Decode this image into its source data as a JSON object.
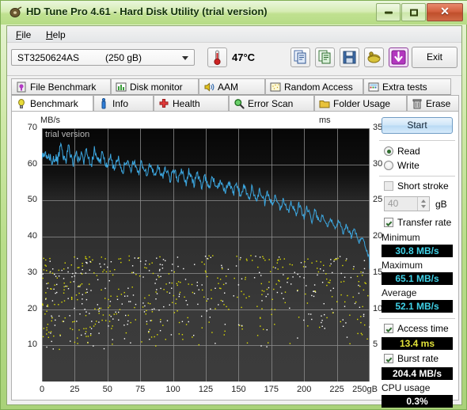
{
  "window": {
    "title": "HD Tune Pro 4.61 - Hard Disk Utility (trial version)",
    "icon": "hdtune-app-icon",
    "minimize_label": "",
    "maximize_label": "",
    "close_label": "✕"
  },
  "menu": [
    {
      "label": "File",
      "accel": "F"
    },
    {
      "label": "Help",
      "accel": "H"
    }
  ],
  "toolbar": {
    "drive_model": "ST3250624AS",
    "drive_capacity": "(250 gB)",
    "temperature": "47°C",
    "temp_icon": "thermometer-icon",
    "buttons": [
      {
        "icon": "copy-icon"
      },
      {
        "icon": "export-icon"
      },
      {
        "icon": "save-icon"
      },
      {
        "icon": "options-icon"
      },
      {
        "icon": "download-arrow-icon"
      }
    ],
    "exit_label": "Exit"
  },
  "tabs_row1": [
    {
      "label": "File Benchmark",
      "icon": "file-benchmark-icon",
      "active": false
    },
    {
      "label": "Disk monitor",
      "icon": "disk-monitor-icon",
      "active": false
    },
    {
      "label": "AAM",
      "icon": "speaker-icon",
      "active": false
    },
    {
      "label": "Random Access",
      "icon": "random-access-icon",
      "active": false
    },
    {
      "label": "Extra tests",
      "icon": "extra-tests-icon",
      "active": false
    }
  ],
  "tabs_row2": [
    {
      "label": "Benchmark",
      "icon": "lightbulb-icon",
      "active": true
    },
    {
      "label": "Info",
      "icon": "info-icon",
      "active": false
    },
    {
      "label": "Health",
      "icon": "health-cross-icon",
      "active": false
    },
    {
      "label": "Error Scan",
      "icon": "magnifier-icon",
      "active": false
    },
    {
      "label": "Folder Usage",
      "icon": "folder-icon",
      "active": false
    },
    {
      "label": "Erase",
      "icon": "trash-icon",
      "active": false
    }
  ],
  "sidebar": {
    "start_label": "Start",
    "mode": [
      {
        "label": "Read",
        "selected": true
      },
      {
        "label": "Write",
        "selected": false
      }
    ],
    "short_stroke": {
      "label": "Short stroke",
      "checked": false,
      "value": "40",
      "unit": "gB"
    },
    "transfer_rate": {
      "label": "Transfer rate",
      "checked": true
    },
    "minimum": {
      "caption": "Minimum",
      "value": "30.8 MB/s"
    },
    "maximum": {
      "caption": "Maximum",
      "value": "65.1 MB/s"
    },
    "average": {
      "caption": "Average",
      "value": "52.1 MB/s"
    },
    "access_time": {
      "label": "Access time",
      "checked": true,
      "value": "13.4 ms"
    },
    "burst_rate": {
      "label": "Burst rate",
      "checked": true,
      "value": "204.4 MB/s"
    },
    "cpu_usage": {
      "caption": "CPU usage",
      "value": "0.3%"
    }
  },
  "chart_data": {
    "type": "line",
    "title": "",
    "watermark": "trial version",
    "xlabel": "",
    "ylabel": "MB/s",
    "ylabel_right": "ms",
    "xlim": [
      0,
      250
    ],
    "ylim": [
      0,
      70
    ],
    "ylim_right": [
      0,
      35
    ],
    "xticks": [
      0,
      25,
      50,
      75,
      100,
      125,
      150,
      175,
      200,
      225,
      250
    ],
    "xtick_labels": [
      "0",
      "25",
      "50",
      "75",
      "100",
      "125",
      "150",
      "175",
      "200",
      "225",
      "250gB"
    ],
    "yticks": [
      10,
      20,
      30,
      40,
      50,
      60,
      70
    ],
    "ytick_labels": [
      "10",
      "20",
      "30",
      "40",
      "50",
      "60",
      "70"
    ],
    "yticks_right": [
      5,
      10,
      15,
      20,
      25,
      30,
      35
    ],
    "ytick_labels_right": [
      "5",
      "10",
      "15",
      "20",
      "25",
      "30",
      "35"
    ],
    "grid": true,
    "legend": "none",
    "series": [
      {
        "name": "Transfer rate",
        "type": "line",
        "color": "#3ca7e0",
        "axis": "left",
        "unit": "MB/s",
        "x": [
          0,
          2,
          4,
          6,
          8,
          10,
          12,
          14,
          16,
          18,
          20,
          22,
          24,
          26,
          28,
          30,
          32,
          34,
          36,
          38,
          40,
          42,
          44,
          46,
          48,
          50,
          52,
          54,
          56,
          58,
          60,
          62,
          64,
          66,
          68,
          70,
          72,
          74,
          76,
          78,
          80,
          82,
          84,
          86,
          88,
          90,
          92,
          94,
          96,
          98,
          100,
          102,
          104,
          106,
          108,
          110,
          112,
          114,
          116,
          118,
          120,
          122,
          124,
          126,
          128,
          130,
          132,
          134,
          136,
          138,
          140,
          142,
          144,
          146,
          148,
          150,
          152,
          154,
          156,
          158,
          160,
          162,
          164,
          166,
          168,
          170,
          172,
          174,
          176,
          178,
          180,
          182,
          184,
          186,
          188,
          190,
          192,
          194,
          196,
          198,
          200,
          202,
          204,
          206,
          208,
          210,
          212,
          214,
          216,
          218,
          220,
          222,
          224,
          226,
          228,
          230,
          232,
          234,
          236,
          238,
          240,
          242,
          244,
          246,
          248,
          250
        ],
        "values": [
          61.5,
          63.0,
          60.8,
          62.5,
          60.3,
          62.0,
          60.6,
          64.8,
          63.0,
          60.5,
          65.1,
          62.4,
          60.3,
          63.4,
          61.0,
          62.9,
          60.7,
          64.5,
          61.6,
          60.2,
          64.1,
          62.2,
          60.1,
          63.2,
          60.4,
          59.8,
          62.4,
          60.0,
          58.9,
          61.8,
          59.9,
          58.2,
          61.4,
          59.6,
          58.0,
          61.0,
          59.2,
          57.6,
          60.6,
          58.8,
          57.0,
          60.2,
          58.4,
          56.6,
          59.8,
          58.0,
          56.2,
          59.4,
          57.6,
          55.8,
          59.0,
          57.2,
          55.4,
          58.6,
          56.8,
          55.0,
          58.0,
          56.2,
          54.4,
          57.6,
          55.8,
          54.0,
          57.0,
          55.2,
          53.4,
          56.6,
          54.8,
          52.8,
          56.0,
          54.2,
          52.2,
          55.4,
          53.6,
          51.6,
          54.8,
          53.0,
          51.0,
          54.2,
          52.4,
          50.4,
          53.6,
          51.8,
          49.8,
          53.0,
          51.2,
          49.2,
          52.2,
          50.4,
          48.4,
          51.4,
          49.6,
          47.6,
          50.6,
          48.8,
          46.8,
          49.8,
          48.0,
          46.0,
          49.0,
          47.2,
          45.2,
          48.2,
          46.4,
          44.4,
          47.4,
          45.6,
          43.6,
          46.4,
          44.6,
          42.8,
          45.4,
          43.8,
          42.0,
          44.4,
          42.8,
          41.0,
          43.4,
          41.8,
          40.0,
          42.0,
          40.4,
          38.6,
          40.2,
          38.2,
          36.0,
          33.5,
          31.0
        ]
      },
      {
        "name": "Access time",
        "type": "scatter",
        "color": "#e0e000",
        "axis": "right",
        "unit": "ms",
        "point_count": 640,
        "x_range": [
          0,
          250
        ],
        "y_range": [
          4.5,
          17.5
        ],
        "note": "dense yellow/white scatter; densest below 12 ms near x<60, spreading upward to ~17 ms across full span"
      }
    ]
  }
}
